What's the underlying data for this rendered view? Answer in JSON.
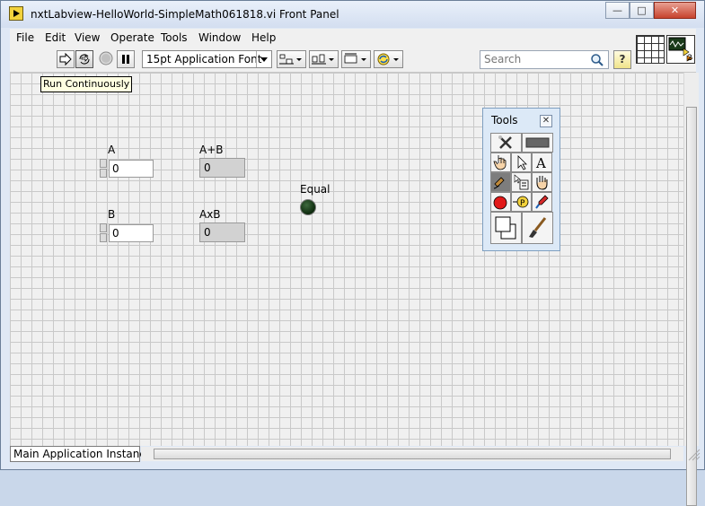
{
  "window": {
    "title": "nxtLabview-HelloWorld-SimpleMath061818.vi Front Panel",
    "caption_buttons": [
      "minimize",
      "maximize",
      "close"
    ]
  },
  "menu": [
    "File",
    "Edit",
    "View",
    "Operate",
    "Tools",
    "Window",
    "Help"
  ],
  "toolbar": {
    "buttons": [
      "run-arrow-icon",
      "run-continuously-icon",
      "abort-icon",
      "pause-icon"
    ],
    "font": "15pt Application Font",
    "align_buttons": [
      "align-objects-icon",
      "distribute-objects-icon",
      "resize-objects-icon",
      "reorder-icon",
      "cleanup-icon"
    ],
    "search_placeholder": "Search",
    "help": "?",
    "vi_icon_number": "2"
  },
  "tooltip": "Run Continuously",
  "front_panel": {
    "controls": [
      {
        "label": "A",
        "value": "0",
        "kind": "numeric-control"
      },
      {
        "label": "B",
        "value": "0",
        "kind": "numeric-control"
      }
    ],
    "indicators": [
      {
        "label": "A+B",
        "value": "0",
        "kind": "numeric-indicator"
      },
      {
        "label": "AxB",
        "value": "0",
        "kind": "numeric-indicator"
      }
    ],
    "led": {
      "label": "Equal",
      "state": "off",
      "color": "#1f3f1f"
    }
  },
  "tools_palette": {
    "title": "Tools",
    "close": "x",
    "tools": [
      "automatic-tool-selection-icon",
      "operate-value-icon",
      "position-select-icon",
      "edit-text-icon",
      "connect-wire-icon",
      "object-shortcut-menu-icon",
      "scroll-window-icon",
      "set-breakpoint-icon",
      "probe-data-icon",
      "get-color-icon",
      "set-color-icon",
      "paintbrush-icon"
    ]
  },
  "statusbar": {
    "instance": "Main Application Instance"
  },
  "colors": {
    "canvas": "#f0f0f0",
    "grid": "#c9c9c9",
    "indicator_bg": "#d2d2d2",
    "tooltip_bg": "#ffffe1"
  }
}
